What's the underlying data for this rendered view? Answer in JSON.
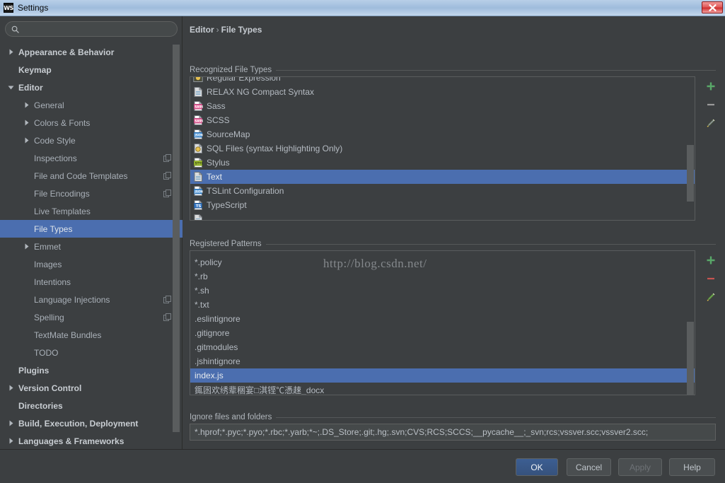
{
  "window": {
    "title": "Settings",
    "app_icon": "webstorm-icon",
    "app_icon_text": "WS",
    "close_label": "✖"
  },
  "search": {
    "placeholder": "",
    "value": "",
    "icon": "search-icon"
  },
  "sidebar": {
    "items": [
      {
        "label": "Appearance & Behavior",
        "level": 0,
        "arrow": "collapsed",
        "bold": true,
        "badge": false,
        "selected": false
      },
      {
        "label": "Keymap",
        "level": 0,
        "arrow": "none",
        "bold": true,
        "badge": false,
        "selected": false
      },
      {
        "label": "Editor",
        "level": 0,
        "arrow": "expanded",
        "bold": true,
        "badge": false,
        "selected": false
      },
      {
        "label": "General",
        "level": 1,
        "arrow": "collapsed",
        "bold": false,
        "badge": false,
        "selected": false
      },
      {
        "label": "Colors & Fonts",
        "level": 1,
        "arrow": "collapsed",
        "bold": false,
        "badge": false,
        "selected": false
      },
      {
        "label": "Code Style",
        "level": 1,
        "arrow": "collapsed",
        "bold": false,
        "badge": false,
        "selected": false
      },
      {
        "label": "Inspections",
        "level": 1,
        "arrow": "none",
        "bold": false,
        "badge": true,
        "selected": false
      },
      {
        "label": "File and Code Templates",
        "level": 1,
        "arrow": "none",
        "bold": false,
        "badge": true,
        "selected": false
      },
      {
        "label": "File Encodings",
        "level": 1,
        "arrow": "none",
        "bold": false,
        "badge": true,
        "selected": false
      },
      {
        "label": "Live Templates",
        "level": 1,
        "arrow": "none",
        "bold": false,
        "badge": false,
        "selected": false
      },
      {
        "label": "File Types",
        "level": 1,
        "arrow": "none",
        "bold": false,
        "badge": false,
        "selected": true
      },
      {
        "label": "Emmet",
        "level": 1,
        "arrow": "collapsed",
        "bold": false,
        "badge": false,
        "selected": false
      },
      {
        "label": "Images",
        "level": 1,
        "arrow": "none",
        "bold": false,
        "badge": false,
        "selected": false
      },
      {
        "label": "Intentions",
        "level": 1,
        "arrow": "none",
        "bold": false,
        "badge": false,
        "selected": false
      },
      {
        "label": "Language Injections",
        "level": 1,
        "arrow": "none",
        "bold": false,
        "badge": true,
        "selected": false
      },
      {
        "label": "Spelling",
        "level": 1,
        "arrow": "none",
        "bold": false,
        "badge": true,
        "selected": false
      },
      {
        "label": "TextMate Bundles",
        "level": 1,
        "arrow": "none",
        "bold": false,
        "badge": false,
        "selected": false
      },
      {
        "label": "TODO",
        "level": 1,
        "arrow": "none",
        "bold": false,
        "badge": false,
        "selected": false
      },
      {
        "label": "Plugins",
        "level": 0,
        "arrow": "none",
        "bold": true,
        "badge": false,
        "selected": false
      },
      {
        "label": "Version Control",
        "level": 0,
        "arrow": "collapsed",
        "bold": true,
        "badge": false,
        "selected": false
      },
      {
        "label": "Directories",
        "level": 0,
        "arrow": "none",
        "bold": true,
        "badge": false,
        "selected": false
      },
      {
        "label": "Build, Execution, Deployment",
        "level": 0,
        "arrow": "collapsed",
        "bold": true,
        "badge": false,
        "selected": false
      },
      {
        "label": "Languages & Frameworks",
        "level": 0,
        "arrow": "collapsed",
        "bold": true,
        "badge": false,
        "selected": false
      }
    ]
  },
  "breadcrumb": {
    "parent": "Editor",
    "separator": "›",
    "current": "File Types"
  },
  "recognized": {
    "group_label": "Recognized File Types",
    "rows": [
      {
        "label": "Regular Expression",
        "icon": "regex-file-icon",
        "selected": false,
        "clipped_top": true
      },
      {
        "label": "RELAX NG Compact Syntax",
        "icon": "text-file-icon",
        "selected": false
      },
      {
        "label": "Sass",
        "icon": "sass-file-icon",
        "selected": false
      },
      {
        "label": "SCSS",
        "icon": "sass-file-icon",
        "selected": false
      },
      {
        "label": "SourceMap",
        "icon": "json-file-icon",
        "selected": false
      },
      {
        "label": "SQL Files (syntax Highlighting Only)",
        "icon": "sql-file-icon",
        "selected": false
      },
      {
        "label": "Stylus",
        "icon": "stylus-file-icon",
        "selected": false
      },
      {
        "label": "Text",
        "icon": "text-file-icon",
        "selected": true
      },
      {
        "label": "TSLint Configuration",
        "icon": "json-file-icon",
        "selected": false
      },
      {
        "label": "TypeScript",
        "icon": "typescript-file-icon",
        "selected": false
      }
    ],
    "tools": [
      {
        "name": "add-file-type-button",
        "glyph": "+",
        "color": "#59a869",
        "enabled": true
      },
      {
        "name": "remove-file-type-button",
        "glyph": "−",
        "color": "#9a9a9a",
        "enabled": false
      },
      {
        "name": "edit-file-type-button",
        "glyph": "pencil-icon",
        "color": "#9a9a9a",
        "enabled": false
      }
    ]
  },
  "patterns": {
    "group_label": "Registered Patterns",
    "watermark": "http://blog.csdn.net/",
    "rows": [
      {
        "label": "*.policy",
        "selected": false
      },
      {
        "label": "*.rb",
        "selected": false
      },
      {
        "label": "*.sh",
        "selected": false
      },
      {
        "label": "*.txt",
        "selected": false
      },
      {
        "label": ".eslintignore",
        "selected": false
      },
      {
        "label": ".gitignore",
        "selected": false
      },
      {
        "label": ".gitmodules",
        "selected": false
      },
      {
        "label": ".jshintignore",
        "selected": false
      },
      {
        "label": "index.js",
        "selected": true
      },
      {
        "label": "銸囦欢绣辈稇宴□淇铿℃憑趚_docx",
        "selected": false
      }
    ],
    "tools": [
      {
        "name": "add-pattern-button",
        "glyph": "+",
        "color": "#59a869",
        "enabled": true
      },
      {
        "name": "remove-pattern-button",
        "glyph": "−",
        "color": "#c75450",
        "enabled": true
      },
      {
        "name": "edit-pattern-button",
        "glyph": "pencil-icon",
        "color": "#59a869",
        "enabled": true
      }
    ]
  },
  "ignore": {
    "group_label": "Ignore files and folders",
    "value": "*.hprof;*.pyc;*.pyo;*.rbc;*.yarb;*~;.DS_Store;.git;.hg;.svn;CVS;RCS;SCCS;__pycache__;_svn;rcs;vssver.scc;vssver2.scc;"
  },
  "buttons": {
    "ok": "OK",
    "cancel": "Cancel",
    "apply": "Apply",
    "help": "Help"
  },
  "colors": {
    "selection_blue": "#4b6eaf",
    "panel_bg": "#3c3f41",
    "field_bg": "#45494a",
    "accent_green": "#59a869",
    "accent_red": "#c75450"
  }
}
